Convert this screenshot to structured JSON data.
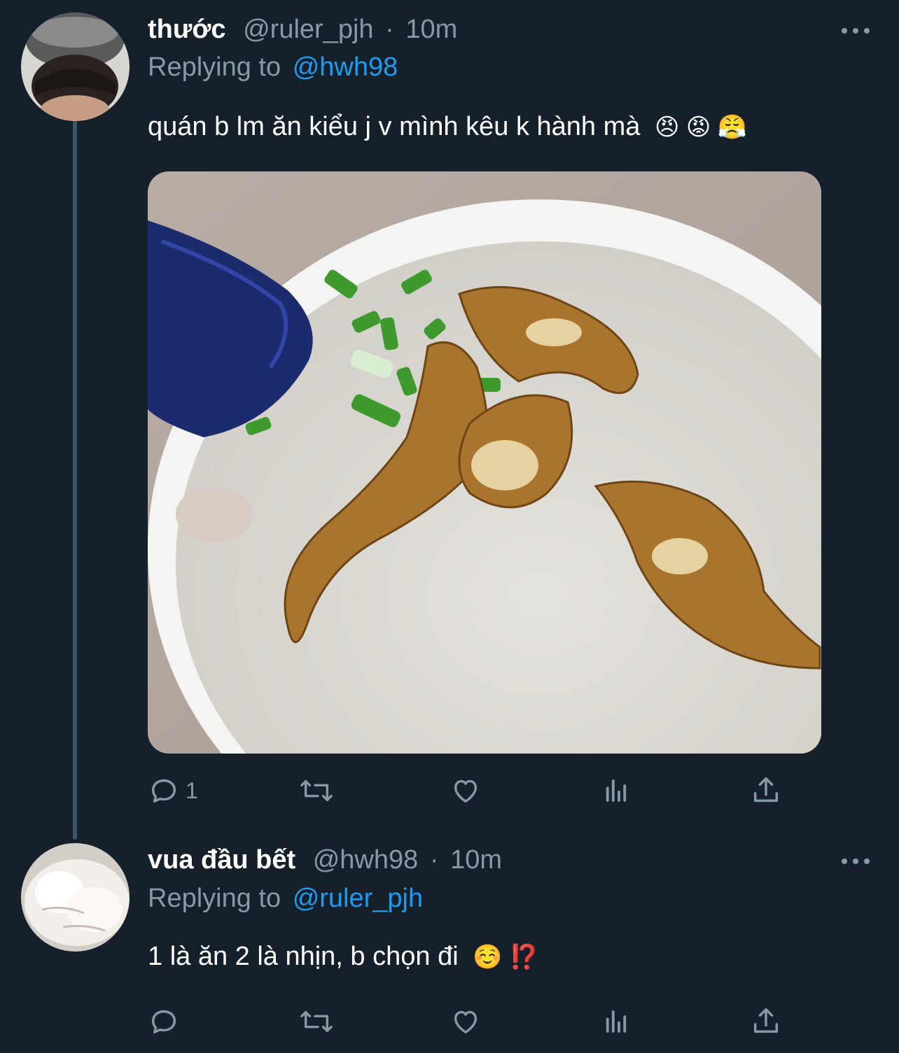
{
  "tweets": [
    {
      "display_name": "thước",
      "handle": "@ruler_pjh",
      "separator": "·",
      "time": "10m",
      "replying_prefix": "Replying to",
      "replying_to": "@hwh98",
      "text": "quán b lm ăn kiểu j v mình kêu k hành mà",
      "emojis": "😠 😡 😤",
      "reply_count": "1",
      "retweet_count": "",
      "like_count": ""
    },
    {
      "display_name": "vua đầu bết",
      "handle": "@hwh98",
      "separator": "·",
      "time": "10m",
      "replying_prefix": "Replying to",
      "replying_to": "@ruler_pjh",
      "text": "1 là ăn 2 là nhịn, b chọn đi",
      "emojis": "☺️ ⁉️",
      "reply_count": "",
      "retweet_count": "",
      "like_count": ""
    }
  ],
  "icons": {
    "more": "more-options-icon",
    "reply": "reply-icon",
    "retweet": "retweet-icon",
    "like": "like-icon",
    "analytics": "analytics-icon",
    "share": "share-icon"
  },
  "colors": {
    "background": "#15202b",
    "muted": "#8899a6",
    "link": "#1d9bf0",
    "thread_line": "#3d5466"
  }
}
